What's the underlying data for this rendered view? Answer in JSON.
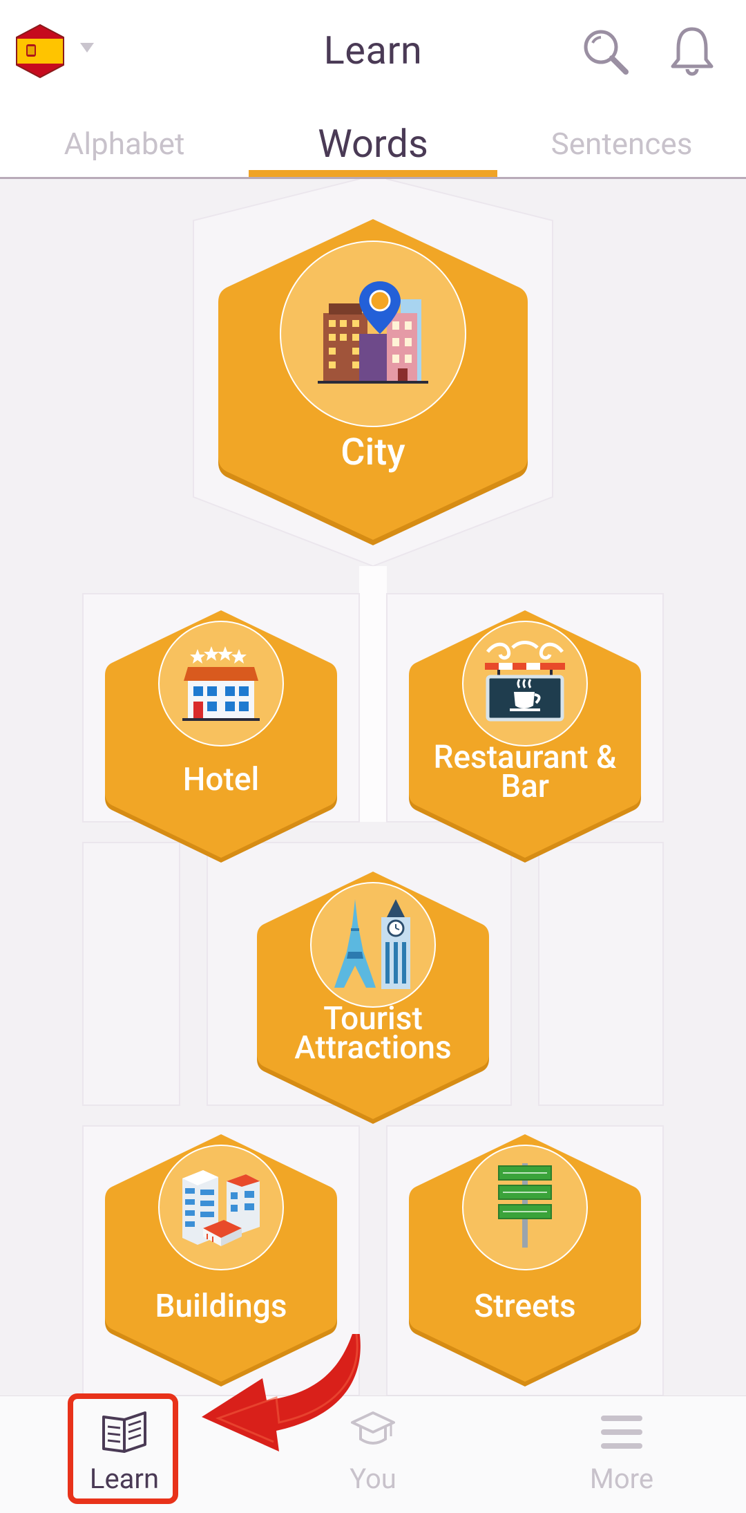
{
  "header": {
    "title": "Learn",
    "language_flag": "spain-flag-icon",
    "search_icon": "search-icon",
    "notifications_icon": "bell-icon"
  },
  "tabs": [
    {
      "label": "Alphabet",
      "active": false
    },
    {
      "label": "Words",
      "active": true
    },
    {
      "label": "Sentences",
      "active": false
    }
  ],
  "topics": [
    {
      "label": "City",
      "icon": "city-icon"
    },
    {
      "label": "Hotel",
      "icon": "hotel-icon"
    },
    {
      "label": "Restaurant & Bar",
      "label_lines": [
        "Restaurant &",
        "Bar"
      ],
      "icon": "cafe-sign-icon"
    },
    {
      "label": "Tourist Attractions",
      "label_lines": [
        "Tourist",
        "Attractions"
      ],
      "icon": "landmarks-icon"
    },
    {
      "label": "Buildings",
      "icon": "buildings-icon"
    },
    {
      "label": "Streets",
      "icon": "street-sign-icon"
    }
  ],
  "bottom_nav": [
    {
      "label": "Learn",
      "icon": "book-icon",
      "active": true
    },
    {
      "label": "You",
      "icon": "graduation-cap-icon",
      "active": false
    },
    {
      "label": "More",
      "icon": "menu-icon",
      "active": false
    }
  ],
  "colors": {
    "accent": "#f0a326",
    "hex_fill": "#f1a626",
    "icon_circle": "#f8c15e",
    "title_text": "#4a3a55",
    "inactive_text": "#c8c2cb",
    "highlight": "#e8321a"
  }
}
